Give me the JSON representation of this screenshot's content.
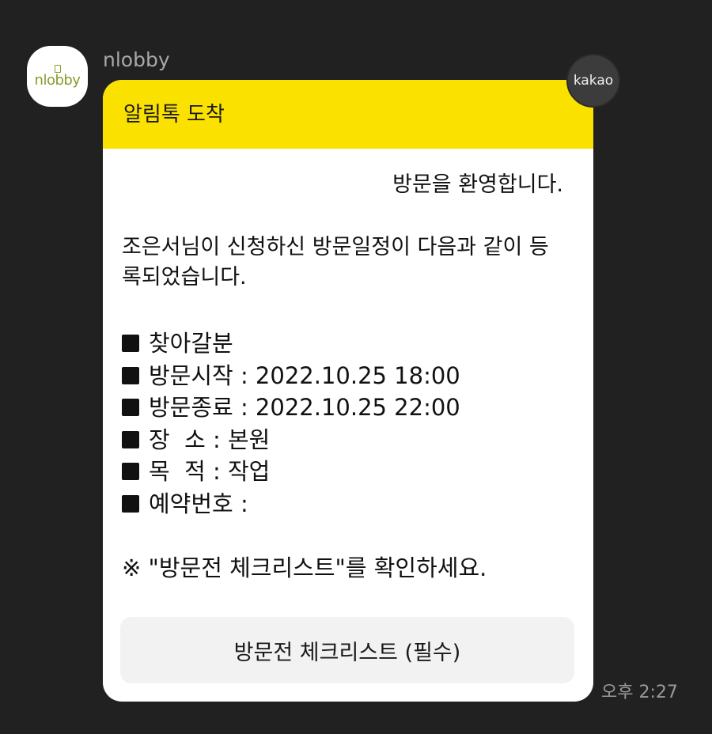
{
  "sender": {
    "name": "nlobby",
    "avatar_logo_text": "nlobby"
  },
  "badge": {
    "label": "kakao"
  },
  "message": {
    "header_title": "알림톡 도착",
    "welcome": "방문을 환영합니다.",
    "intro": "조은서님이 신청하신 방문일정이 다음과 같이 등록되었습니다.",
    "details": [
      "찾아갈분",
      "방문시작 : 2022.10.25 18:00",
      "방문종료 : 2022.10.25 22:00",
      "장  소 : 본원",
      "목  적 : 작업",
      "예약번호 :"
    ],
    "notice": "※ \"방문전 체크리스트\"를 확인하세요.",
    "button_label": "방문전 체크리스트 (필수)",
    "timestamp": "오후 2:27"
  },
  "colors": {
    "background": "#212121",
    "header_yellow": "#fae100",
    "bubble": "#ffffff",
    "button": "#f2f2f2",
    "logo_green": "#8a9a2a"
  }
}
